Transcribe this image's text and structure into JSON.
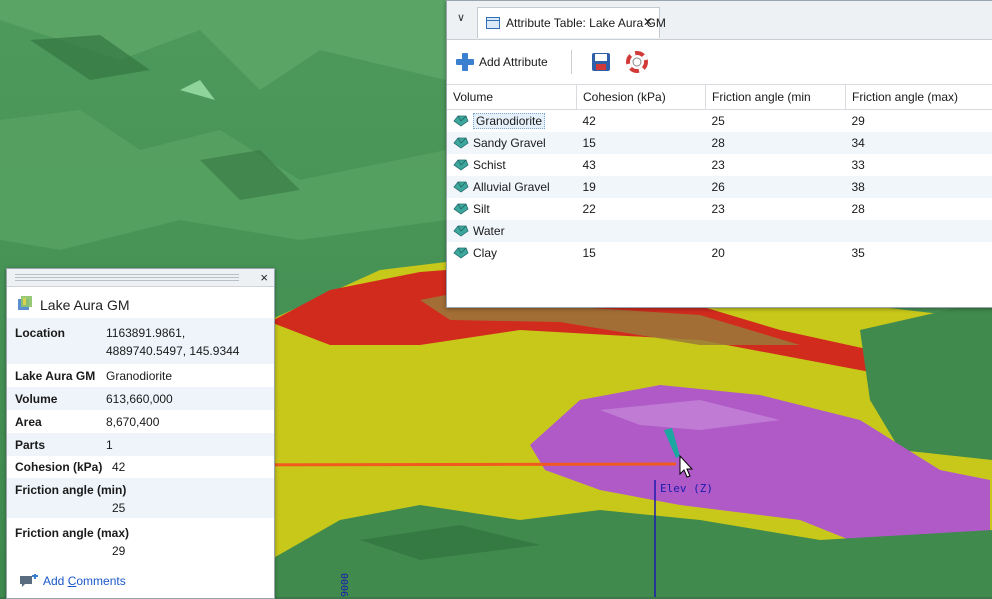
{
  "attribute_table": {
    "tab_title": "Attribute Table: Lake Aura GM",
    "tab_close": "✕",
    "tab_menu": "∨",
    "add_attribute_label": "Add Attribute",
    "columns": [
      "Volume",
      "Cohesion (kPa)",
      "Friction angle (min",
      "Friction angle (max)"
    ],
    "rows": [
      {
        "volume": "Granodiorite",
        "cohesion": "42",
        "fmin": "25",
        "fmax": "29",
        "selected": true
      },
      {
        "volume": "Sandy Gravel",
        "cohesion": "15",
        "fmin": "28",
        "fmax": "34"
      },
      {
        "volume": "Schist",
        "cohesion": "43",
        "fmin": "23",
        "fmax": "33"
      },
      {
        "volume": "Alluvial Gravel",
        "cohesion": "19",
        "fmin": "26",
        "fmax": "38"
      },
      {
        "volume": "Silt",
        "cohesion": "22",
        "fmin": "23",
        "fmax": "28"
      },
      {
        "volume": "Water",
        "cohesion": "",
        "fmin": "",
        "fmax": ""
      },
      {
        "volume": "Clay",
        "cohesion": "15",
        "fmin": "20",
        "fmax": "35"
      }
    ]
  },
  "properties": {
    "title": "Lake Aura GM",
    "close": "×",
    "location_label": "Location",
    "location_line1": "1163891.9861,",
    "location_line2": "4889740.5497, 145.9344",
    "model_label": "Lake Aura GM",
    "model_value": "Granodiorite",
    "volume_label": "Volume",
    "volume_value": "613,660,000",
    "area_label": "Area",
    "area_value": "8,670,400",
    "parts_label": "Parts",
    "parts_value": "1",
    "cohesion_label": "Cohesion (kPa)",
    "cohesion_value": "42",
    "fmin_label": "Friction angle (min)",
    "fmin_value": "25",
    "fmax_label": "Friction angle (max)",
    "fmax_value": "29",
    "add_comments_prefix": "Add ",
    "add_comments_underlined": "C",
    "add_comments_rest": "omments"
  },
  "viewport": {
    "axis_label": "Elev (Z)",
    "tick_label": "9000",
    "colors": {
      "terrain_green": "#3f8a4c",
      "granodiorite_red": "#d12b1e",
      "yellow_layer": "#c8c81a",
      "purple_layer": "#b05ac8",
      "arrow": "#f05a1e",
      "axis": "#1b1bb0"
    }
  },
  "icons": [
    "add-attribute-icon",
    "save-icon",
    "help-lifebuoy-icon",
    "table-icon",
    "gem-volume-icon",
    "geology-model-icon",
    "add-comment-icon"
  ]
}
